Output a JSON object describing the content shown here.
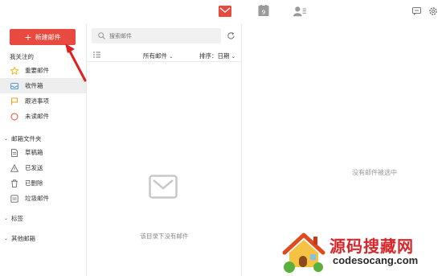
{
  "topbar": {
    "icons": [
      "mail-icon",
      "calendar-icon",
      "contacts-icon",
      "chat-icon",
      "gear-icon"
    ],
    "calendar_day": "9",
    "accent": "#e84a3f"
  },
  "sidebar": {
    "compose_label": "新建邮件",
    "followed_title": "我关注的",
    "followed_items": [
      {
        "label": "重要邮件",
        "icon": "star-icon"
      },
      {
        "label": "收件箱",
        "icon": "inbox-icon"
      },
      {
        "label": "跟进事项",
        "icon": "flag-icon"
      },
      {
        "label": "未读邮件",
        "icon": "circle-icon"
      }
    ],
    "folders_title": "邮箱文件夹",
    "folder_items": [
      {
        "label": "草稿箱",
        "icon": "draft-icon"
      },
      {
        "label": "已发送",
        "icon": "sent-icon"
      },
      {
        "label": "已删除",
        "icon": "trash-icon"
      },
      {
        "label": "垃圾邮件",
        "icon": "spam-icon"
      }
    ],
    "tags_title": "标签",
    "other_title": "其他邮箱"
  },
  "list": {
    "search_placeholder": "搜索邮件",
    "filter_label": "所有邮件",
    "sort_label": "排序：日期",
    "empty_text": "该目录下没有邮件"
  },
  "reading": {
    "none_selected": "没有邮件被选中"
  },
  "watermark": {
    "title": "源码搜藏网",
    "url": "codesocang.com"
  }
}
